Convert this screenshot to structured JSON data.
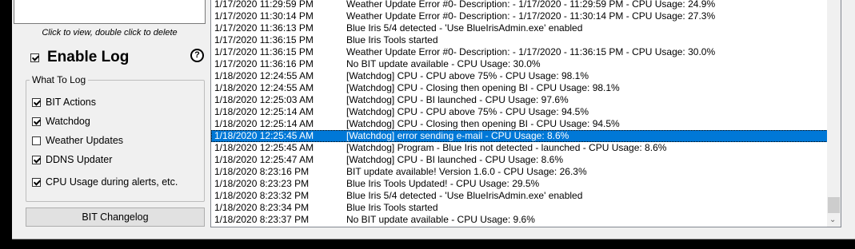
{
  "left": {
    "hint": "Click to view, double click to delete",
    "enable_log_label": "Enable Log",
    "enable_log_checked": true,
    "help_glyph": "?",
    "group_title": "What To Log",
    "options": [
      {
        "label": "BIT Actions",
        "checked": true
      },
      {
        "label": "Watchdog",
        "checked": true
      },
      {
        "label": "Weather Updates",
        "checked": false
      },
      {
        "label": "DDNS Updater",
        "checked": true
      },
      {
        "label": "CPU Usage during alerts, etc.",
        "checked": true
      }
    ],
    "changelog_button": "BIT Changelog"
  },
  "log": {
    "selected_index": 11,
    "rows": [
      {
        "time": "1/17/2020 11:29:59 PM",
        "msg": "Weather Update Error #0- Description:  - 1/17/2020 - 11:29:59 PM - CPU Usage: 24.9%"
      },
      {
        "time": "1/17/2020 11:30:14 PM",
        "msg": "Weather Update Error #0- Description:  - 1/17/2020 - 11:30:14 PM - CPU Usage: 27.3%"
      },
      {
        "time": "1/17/2020 11:36:13 PM",
        "msg": "Blue Iris 5/4 detected - 'Use BlueIrisAdmin.exe' enabled"
      },
      {
        "time": "1/17/2020 11:36:15 PM",
        "msg": "Blue Iris Tools started"
      },
      {
        "time": "1/17/2020 11:36:15 PM",
        "msg": "Weather Update Error #0- Description:  - 1/17/2020 - 11:36:15 PM - CPU Usage: 30.0%"
      },
      {
        "time": "1/17/2020 11:36:16 PM",
        "msg": "No BIT update available - CPU Usage: 30.0%"
      },
      {
        "time": "1/18/2020 12:24:55 AM",
        "msg": "[Watchdog] CPU - CPU above 75% - CPU Usage: 98.1%"
      },
      {
        "time": "1/18/2020 12:24:55 AM",
        "msg": "[Watchdog] CPU - Closing then opening BI - CPU Usage: 98.1%"
      },
      {
        "time": "1/18/2020 12:25:03 AM",
        "msg": "[Watchdog] CPU - BI launched - CPU Usage: 97.6%"
      },
      {
        "time": "1/18/2020 12:25:14 AM",
        "msg": "[Watchdog] CPU - CPU above 75% - CPU Usage: 94.5%"
      },
      {
        "time": "1/18/2020 12:25:14 AM",
        "msg": "[Watchdog] CPU - Closing then opening BI - CPU Usage: 94.5%"
      },
      {
        "time": "1/18/2020 12:25:45 AM",
        "msg": "[Watchdog] error sending e-mail - CPU Usage: 8.6%"
      },
      {
        "time": "1/18/2020 12:25:45 AM",
        "msg": "[Watchdog] Program - Blue Iris not detected - launched - CPU Usage: 8.6%"
      },
      {
        "time": "1/18/2020 12:25:47 AM",
        "msg": "[Watchdog] CPU - BI launched - CPU Usage: 8.6%"
      },
      {
        "time": "1/18/2020 8:23:16 PM",
        "msg": "BIT update available! Version 1.6.0 - CPU Usage: 26.3%"
      },
      {
        "time": "1/18/2020 8:23:23 PM",
        "msg": "Blue Iris Tools Updated! - CPU Usage: 29.5%"
      },
      {
        "time": "1/18/2020 8:23:32 PM",
        "msg": "Blue Iris 5/4 detected - 'Use BlueIrisAdmin.exe' enabled"
      },
      {
        "time": "1/18/2020 8:23:34 PM",
        "msg": "Blue Iris Tools started"
      },
      {
        "time": "1/18/2020 8:23:37 PM",
        "msg": "No BIT update available - CPU Usage: 9.6%"
      }
    ],
    "scroll_down_glyph": "⌄"
  }
}
